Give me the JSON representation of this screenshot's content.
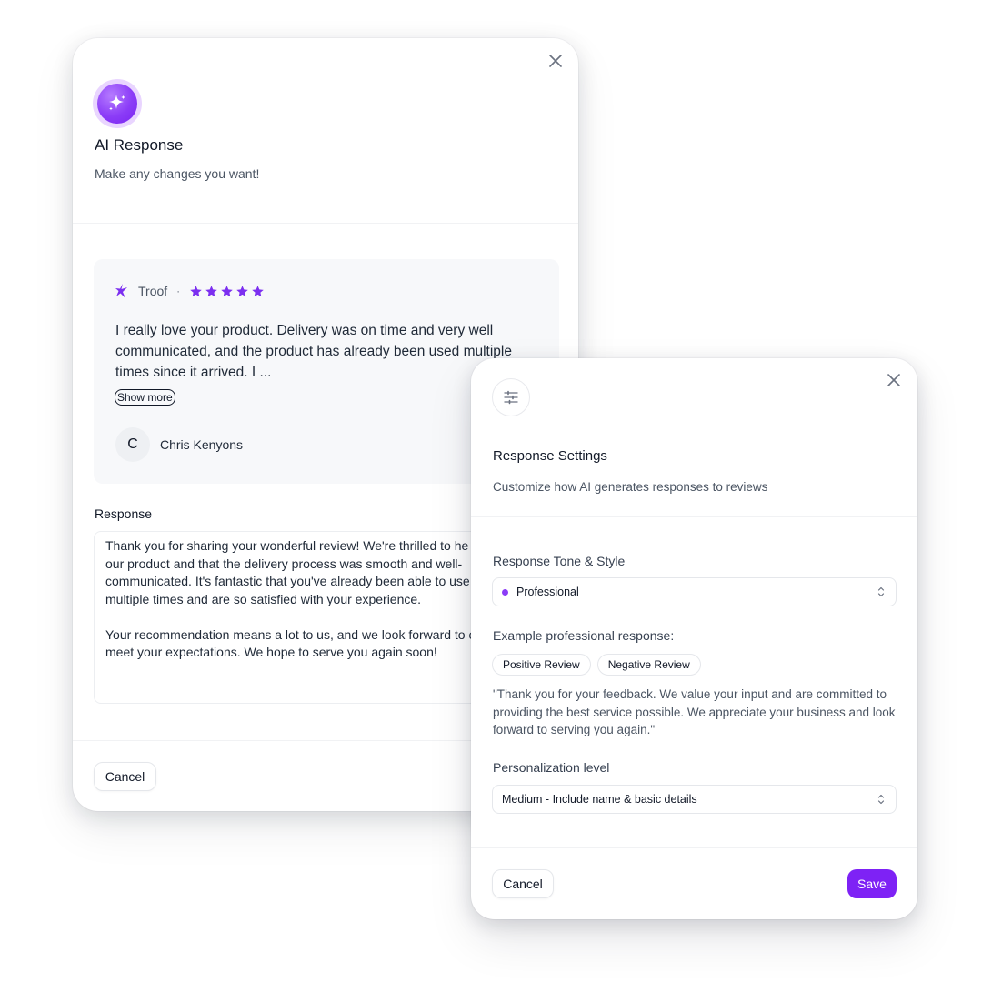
{
  "ai_response_modal": {
    "title": "AI Response",
    "subtitle": "Make any changes you want!",
    "review": {
      "brand": "Troof",
      "separator": "·",
      "rating": 5,
      "text": "I really love your product. Delivery was on time and very well communicated, and the product has already been used multiple times since it arrived. I ...",
      "show_more_label": "Show more",
      "reviewer_initial": "C",
      "reviewer_name": "Chris Kenyons"
    },
    "response_label": "Response",
    "response_text": "Thank you for sharing your wonderful review! We're thrilled to he\nour product and that the delivery process was smooth and well-\ncommunicated. It's fantastic that you've already been able to use\nmultiple times and are so satisfied with your experience.\n\nYour recommendation means a lot to us, and we look forward to c\nmeet your expectations. We hope to serve you again soon!",
    "cancel_label": "Cancel"
  },
  "response_settings_modal": {
    "title": "Response Settings",
    "subtitle": "Customize how AI generates responses to reviews",
    "tone_label": "Response Tone & Style",
    "tone_value": "Professional",
    "example_label": "Example professional response:",
    "tabs": [
      {
        "label": "Positive Review"
      },
      {
        "label": "Negative Review"
      }
    ],
    "example_text": "\"Thank you for your feedback. We value your input and are committed to providing the best service possible. We appreciate your business and look forward to serving you again.\"",
    "personalization_label": "Personalization level",
    "personalization_value": "Medium - Include name & basic details",
    "cancel_label": "Cancel",
    "save_label": "Save"
  },
  "colors": {
    "accent": "#7e22f5",
    "star": "#7c2ff0",
    "card_bg": "#f7f8fa"
  },
  "icons": [
    "close-icon",
    "sparkles-icon",
    "troof-logo-icon",
    "star-icon",
    "sliders-icon",
    "chevron-up-down-icon"
  ]
}
